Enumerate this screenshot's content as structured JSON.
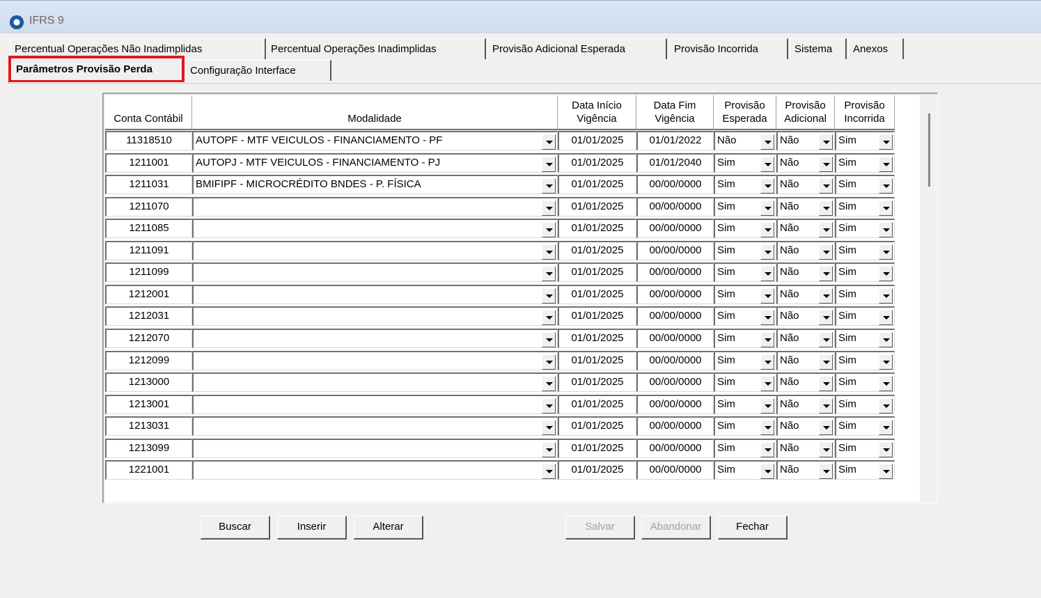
{
  "app": {
    "title": "IFRS 9"
  },
  "tabs": {
    "row1": [
      "Percentual Operações Não Inadimplidas",
      "Percentual Operações Inadimplidas",
      "Provisão Adicional Esperada",
      "Provisão Incorrida",
      "Sistema",
      "Anexos"
    ],
    "row2": [
      "Parâmetros Provisão Perda",
      "Configuração Interface"
    ],
    "active": "Parâmetros Provisão Perda"
  },
  "grid": {
    "headers": {
      "conta": "Conta Contábil",
      "modalidade": "Modalidade",
      "data_inicio": [
        "Data Início",
        "Vigência"
      ],
      "data_fim": [
        "Data Fim",
        "Vigência"
      ],
      "prov_esperada": [
        "Provisão",
        "Esperada"
      ],
      "prov_adicional": [
        "Provisão",
        "Adicional"
      ],
      "prov_incorrida": [
        "Provisão",
        "Incorrida"
      ]
    },
    "rows": [
      {
        "conta": "11318510",
        "modalidade": "AUTOPF - MTF VEICULOS - FINANCIAMENTO - PF",
        "inicio": "01/01/2025",
        "fim": "01/01/2022",
        "esperada": "Não",
        "adicional": "Não",
        "incorrida": "Sim"
      },
      {
        "conta": "1211001",
        "modalidade": "AUTOPJ - MTF VEICULOS - FINANCIAMENTO - PJ",
        "inicio": "01/01/2025",
        "fim": "01/01/2040",
        "esperada": "Sim",
        "adicional": "Não",
        "incorrida": "Sim"
      },
      {
        "conta": "1211031",
        "modalidade": "BMIFIPF - MICROCRÉDITO BNDES - P. FÍSICA",
        "inicio": "01/01/2025",
        "fim": "00/00/0000",
        "esperada": "Sim",
        "adicional": "Não",
        "incorrida": "Sim"
      },
      {
        "conta": "1211070",
        "modalidade": "",
        "inicio": "01/01/2025",
        "fim": "00/00/0000",
        "esperada": "Sim",
        "adicional": "Não",
        "incorrida": "Sim"
      },
      {
        "conta": "1211085",
        "modalidade": "",
        "inicio": "01/01/2025",
        "fim": "00/00/0000",
        "esperada": "Sim",
        "adicional": "Não",
        "incorrida": "Sim"
      },
      {
        "conta": "1211091",
        "modalidade": "",
        "inicio": "01/01/2025",
        "fim": "00/00/0000",
        "esperada": "Sim",
        "adicional": "Não",
        "incorrida": "Sim"
      },
      {
        "conta": "1211099",
        "modalidade": "",
        "inicio": "01/01/2025",
        "fim": "00/00/0000",
        "esperada": "Sim",
        "adicional": "Não",
        "incorrida": "Sim"
      },
      {
        "conta": "1212001",
        "modalidade": "",
        "inicio": "01/01/2025",
        "fim": "00/00/0000",
        "esperada": "Sim",
        "adicional": "Não",
        "incorrida": "Sim"
      },
      {
        "conta": "1212031",
        "modalidade": "",
        "inicio": "01/01/2025",
        "fim": "00/00/0000",
        "esperada": "Sim",
        "adicional": "Não",
        "incorrida": "Sim"
      },
      {
        "conta": "1212070",
        "modalidade": "",
        "inicio": "01/01/2025",
        "fim": "00/00/0000",
        "esperada": "Sim",
        "adicional": "Não",
        "incorrida": "Sim"
      },
      {
        "conta": "1212099",
        "modalidade": "",
        "inicio": "01/01/2025",
        "fim": "00/00/0000",
        "esperada": "Sim",
        "adicional": "Não",
        "incorrida": "Sim"
      },
      {
        "conta": "1213000",
        "modalidade": "",
        "inicio": "01/01/2025",
        "fim": "00/00/0000",
        "esperada": "Sim",
        "adicional": "Não",
        "incorrida": "Sim"
      },
      {
        "conta": "1213001",
        "modalidade": "",
        "inicio": "01/01/2025",
        "fim": "00/00/0000",
        "esperada": "Sim",
        "adicional": "Não",
        "incorrida": "Sim"
      },
      {
        "conta": "1213031",
        "modalidade": "",
        "inicio": "01/01/2025",
        "fim": "00/00/0000",
        "esperada": "Sim",
        "adicional": "Não",
        "incorrida": "Sim"
      },
      {
        "conta": "1213099",
        "modalidade": "",
        "inicio": "01/01/2025",
        "fim": "00/00/0000",
        "esperada": "Sim",
        "adicional": "Não",
        "incorrida": "Sim"
      },
      {
        "conta": "1221001",
        "modalidade": "",
        "inicio": "01/01/2025",
        "fim": "00/00/0000",
        "esperada": "Sim",
        "adicional": "Não",
        "incorrida": "Sim"
      }
    ]
  },
  "buttons": {
    "buscar": "Buscar",
    "inserir": "Inserir",
    "alterar": "Alterar",
    "salvar": "Salvar",
    "abandonar": "Abandonar",
    "fechar": "Fechar"
  },
  "colors": {
    "highlight": "#e0191d"
  }
}
